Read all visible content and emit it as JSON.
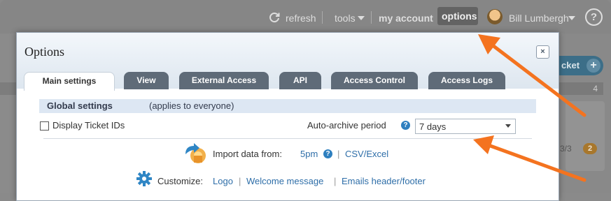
{
  "topnav": {
    "refresh_label": "refresh",
    "tools_label": "tools",
    "account_label": "my account",
    "options_label": "options",
    "user_name": "Bill Lumbergh",
    "help_glyph": "?"
  },
  "background": {
    "new_ticket_label": "cket",
    "plus_glyph": "+",
    "count": "4",
    "ratio": "3/3",
    "badge": "2"
  },
  "dialog": {
    "title": "Options",
    "close_glyph": "×",
    "tabs": [
      {
        "label": "Main settings",
        "active": true
      },
      {
        "label": "View"
      },
      {
        "label": "External Access"
      },
      {
        "label": "API"
      },
      {
        "label": "Access Control"
      },
      {
        "label": "Access Logs"
      }
    ],
    "global_heading": "Global settings",
    "global_note": "(applies to everyone)",
    "display_ticket_ids_label": "Display Ticket IDs",
    "display_ticket_ids_checked": false,
    "auto_archive_label": "Auto-archive period",
    "auto_archive_value": "7 days",
    "import_label": "Import data from:",
    "import_links": [
      "5pm",
      "CSV/Excel"
    ],
    "customize_label": "Customize:",
    "customize_links": [
      "Logo",
      "Welcome message",
      "Emails header/footer"
    ],
    "sep_glyph": "|",
    "help_glyph": "?"
  },
  "colors": {
    "accent_arrow": "#f4731f",
    "tab_dark": "#5f6b78",
    "link": "#2e6ea8",
    "help_badge": "#2e7fbf"
  },
  "icons": [
    "refresh-icon",
    "chevron-down-icon",
    "avatar",
    "help-icon",
    "close-icon",
    "help-badge-icon",
    "import-icon",
    "gear-icon",
    "annotation-arrow"
  ]
}
